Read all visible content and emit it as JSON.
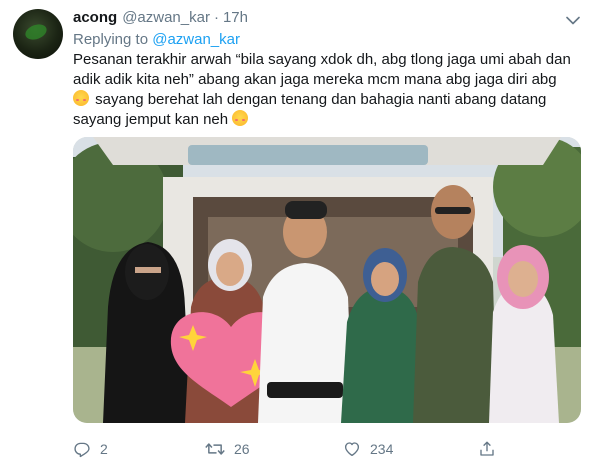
{
  "tweet": {
    "author_name": "acong",
    "author_handle": "@azwan_kar",
    "separator": "·",
    "timestamp": "17h",
    "replying_prefix": "Replying to",
    "replying_handle": "@azwan_kar",
    "text_part1": "Pesanan terakhir arwah “bila sayang xdok dh, abg tlong jaga umi abah dan adik adik kita neh” abang akan jaga mereka mcm mana abg jaga diri abg ",
    "text_part2": " sayang berehat lah dengan tenang dan bahagia nanti abang datang sayang jemput kan neh ",
    "emoji_1": "smiling-face-with-blush-emoji",
    "emoji_2": "smiling-face-with-blush-emoji",
    "photo": "group-photo-family-in-front-of-car-trunk"
  },
  "actions": {
    "reply_count": "2",
    "retweet_count": "26",
    "like_count": "234"
  },
  "icons": {
    "caret": "chevron-down-icon",
    "reply": "reply-icon",
    "retweet": "retweet-icon",
    "like": "heart-icon",
    "share": "share-icon"
  },
  "colors": {
    "text": "#14171a",
    "secondary": "#657786",
    "link": "#1da1f2"
  }
}
